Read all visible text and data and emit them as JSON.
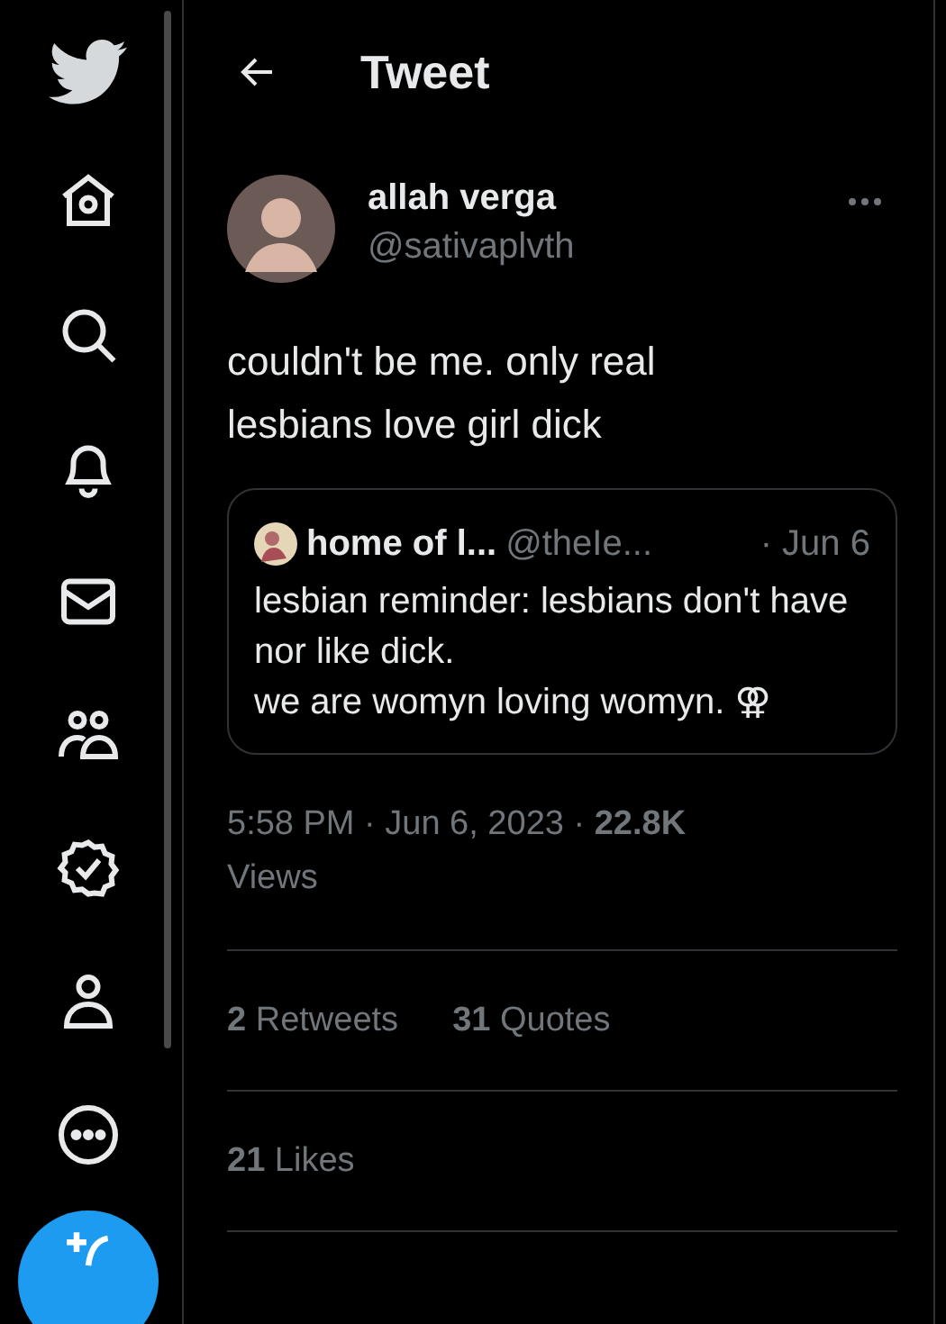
{
  "header": {
    "title": "Tweet"
  },
  "tweet": {
    "author": {
      "name": "allah verga",
      "handle": "@sativaplvth"
    },
    "text": "couldn't be me. only real lesbians love girl dick",
    "quote": {
      "name": "home of l...",
      "handle": "@theIe...",
      "date": "· Jun 6",
      "lines": [
        "lesbian reminder: lesbians don't have nor like dick.",
        "we are womyn loving womyn. ⚢"
      ]
    },
    "meta": "5:58 PM · Jun 6, 2023 · **22.8K** Views",
    "stat_rows": [
      [
        "**2** Retweets",
        "**31** Quotes"
      ],
      [
        "**21** Likes"
      ]
    ]
  }
}
